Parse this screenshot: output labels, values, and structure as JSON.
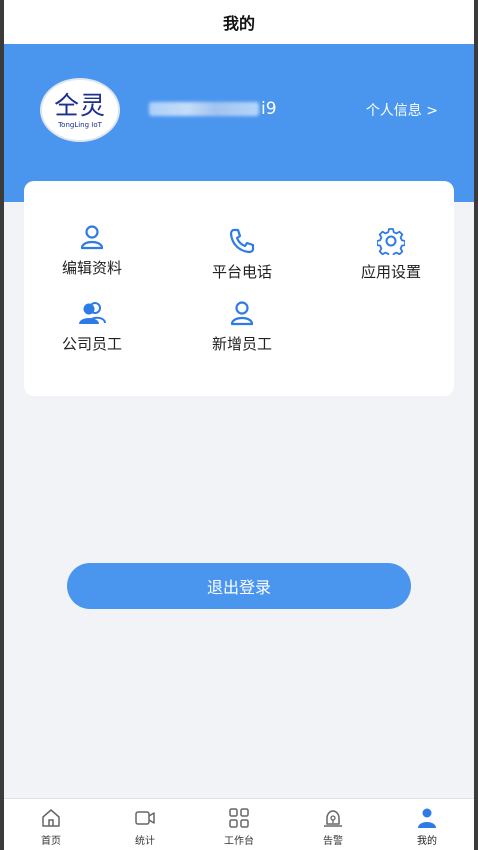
{
  "nav": {
    "title": "我的"
  },
  "header": {
    "logo_cn": "仝灵",
    "logo_en": "TongLing IoT",
    "username_tail": "i9",
    "profile_link": "个人信息 >"
  },
  "grid": {
    "items": [
      {
        "label": "编辑资料",
        "icon": "user-outline-icon"
      },
      {
        "label": "平台电话",
        "icon": "phone-icon"
      },
      {
        "label": "应用设置",
        "icon": "gear-icon"
      },
      {
        "label": "公司员工",
        "icon": "users-icon"
      },
      {
        "label": "新增员工",
        "icon": "user-add-icon"
      }
    ]
  },
  "logout": {
    "label": "退出登录"
  },
  "tabbar": {
    "items": [
      {
        "label": "首页",
        "icon": "home-icon"
      },
      {
        "label": "统计",
        "icon": "video-icon"
      },
      {
        "label": "工作台",
        "icon": "grid-icon"
      },
      {
        "label": "告警",
        "icon": "alarm-icon"
      },
      {
        "label": "我的",
        "icon": "user-filled-icon",
        "active": true
      }
    ]
  },
  "colors": {
    "brand": "#4a96ef",
    "icon_blue": "#2f7be6"
  }
}
